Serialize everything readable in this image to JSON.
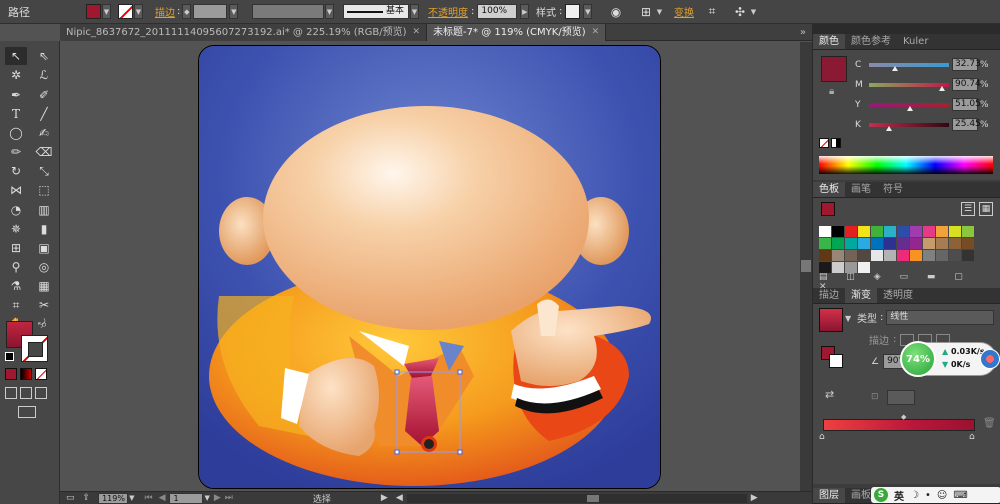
{
  "control": {
    "path_label": "路径",
    "stroke_label": "描边",
    "brush_label": "基本",
    "opacity_label": "不透明度",
    "opacity_value": "100%",
    "style_label": "样式",
    "transform_label": "变换",
    "fill_color": "#a01830"
  },
  "tabs": [
    {
      "label": "Nipic_8637672_20111114095607273192.ai* @ 225.19% (RGB/预览)"
    },
    {
      "label": "未标题-7* @ 119% (CMYK/预览)"
    }
  ],
  "color_panel": {
    "tabs": [
      "颜色",
      "颜色参考",
      "Kuler"
    ],
    "swatch": "#8a1a33",
    "channels": [
      {
        "label": "C",
        "value": "32.73",
        "unit": "%",
        "pos": 0.33
      },
      {
        "label": "M",
        "value": "90.74",
        "unit": "%",
        "pos": 0.91
      },
      {
        "label": "Y",
        "value": "51.05",
        "unit": "%",
        "pos": 0.51
      },
      {
        "label": "K",
        "value": "25.45",
        "unit": "%",
        "pos": 0.25
      }
    ]
  },
  "swatches_panel": {
    "tabs": [
      "色板",
      "画笔",
      "符号"
    ]
  },
  "gradient_panel": {
    "tabs": [
      "描边",
      "渐变",
      "透明度"
    ],
    "type_label": "类型",
    "type_value": "线性",
    "stroke_label": "描边",
    "angle_value": "90°"
  },
  "network_widget": {
    "percent": "74%",
    "up": "0.03K/s",
    "down": "0K/s"
  },
  "status": {
    "zoom": "119%",
    "page": "1",
    "tool": "选择"
  },
  "panel_bottom": {
    "tabs": [
      "图层",
      "画板"
    ],
    "ime": "英"
  },
  "colors": {
    "bg_blue": "#3d52b0",
    "skin": "#f3bf8e",
    "orange": "#f29a1e"
  }
}
